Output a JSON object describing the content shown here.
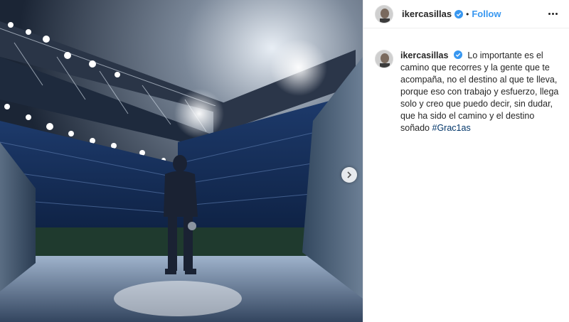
{
  "post": {
    "username": "ikercasillas",
    "follow_label": "Follow",
    "separator": "•",
    "caption_text": "Lo importante es el camino que recorres y la gente que te acompaña, no el destino al que te lleva, porque eso con trabajo y esfuerzo, llega solo y creo que puedo decir, sin dudar, que ha sido el camino y el destino soñado",
    "hashtag": "#Grac1as"
  },
  "colors": {
    "link_blue": "#3897f0",
    "hashtag_blue": "#003569",
    "verified_blue": "#3897f0"
  },
  "icons": {
    "verified": "verified-badge-icon",
    "more": "more-options-icon",
    "next": "chevron-right-icon"
  }
}
